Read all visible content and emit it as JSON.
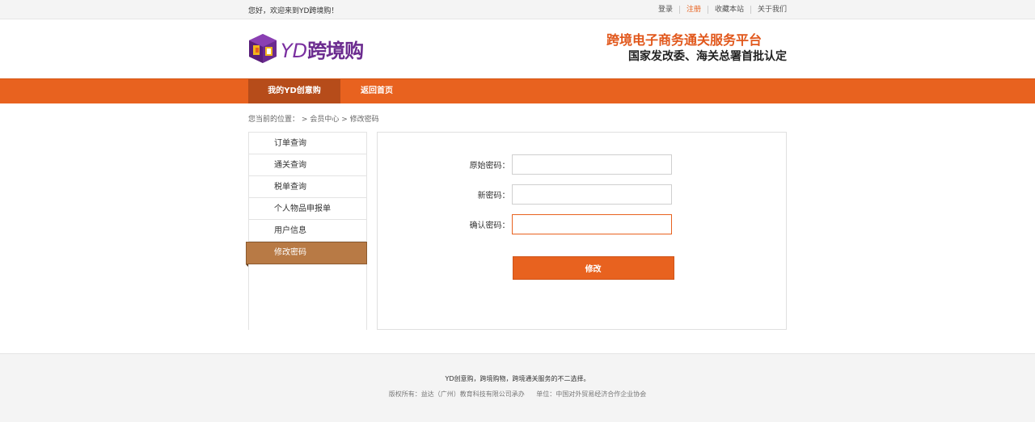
{
  "topbar": {
    "welcome": "您好，欢迎来到YD跨境购！",
    "links": [
      "登录",
      "注册",
      "收藏本站",
      "关于我们"
    ]
  },
  "header": {
    "logo_yd": "YD",
    "logo_name": "跨境购",
    "slogan_line1": "跨境电子商务通关服务平台",
    "slogan_line2": "国家发改委、海关总署首批认定"
  },
  "nav": {
    "items": [
      "我的YD创意购",
      "返回首页"
    ]
  },
  "breadcrumb": {
    "prefix": "您当前的位置：",
    "sep": ">",
    "level1": "会员中心",
    "level2": "修改密码"
  },
  "sidebar": {
    "items": [
      "订单查询",
      "通关查询",
      "税单查询",
      "个人物品申报单",
      "用户信息",
      "修改密码"
    ],
    "active_index": 5
  },
  "form": {
    "old_label": "原始密码：",
    "new_label": "新密码：",
    "confirm_label": "确认密码：",
    "old_value": "",
    "new_value": "",
    "confirm_value": "",
    "submit_label": "修改"
  },
  "footer": {
    "line1": "YD创意购，跨境购物，跨境通关服务的不二选择。",
    "copyright": "版权所有：益达（广州）教育科技有限公司承办",
    "unit": "单位：中国对外贸易经济合作企业协会"
  },
  "colors": {
    "accent": "#e8621f",
    "nav_active": "#b64c1a",
    "sidebar_active": "#b87a45",
    "logo": "#6b2b8f"
  }
}
